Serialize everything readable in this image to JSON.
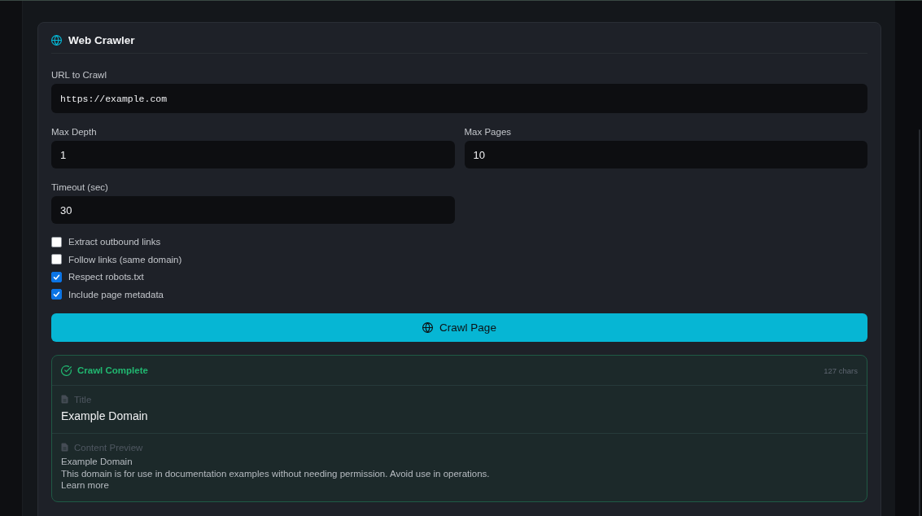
{
  "tool": {
    "title": "Web Crawler"
  },
  "fields": [
    {
      "label": "URL to Crawl",
      "value": "https://example.com",
      "kind": "url"
    },
    {
      "label": "Max Depth",
      "value": "1",
      "kind": "number"
    },
    {
      "label": "Max Pages",
      "value": "10",
      "kind": "number"
    },
    {
      "label": "Timeout (sec)",
      "value": "30",
      "kind": "number"
    }
  ],
  "options": [
    {
      "label": "Extract outbound links",
      "checked": false
    },
    {
      "label": "Follow links (same domain)",
      "checked": false
    },
    {
      "label": "Respect robots.txt",
      "checked": true
    },
    {
      "label": "Include page metadata",
      "checked": true
    }
  ],
  "button": {
    "label": "Crawl Page"
  },
  "result": {
    "status": "Crawl Complete",
    "size": "127 chars",
    "sections": [
      {
        "kind": "title",
        "label": "Title",
        "value": "Example Domain"
      },
      {
        "kind": "preview",
        "label": "Content Preview",
        "lines": [
          "Example Domain",
          "This domain is for use in documentation examples without needing permission. Avoid use in operations.",
          "Learn more"
        ]
      }
    ]
  }
}
